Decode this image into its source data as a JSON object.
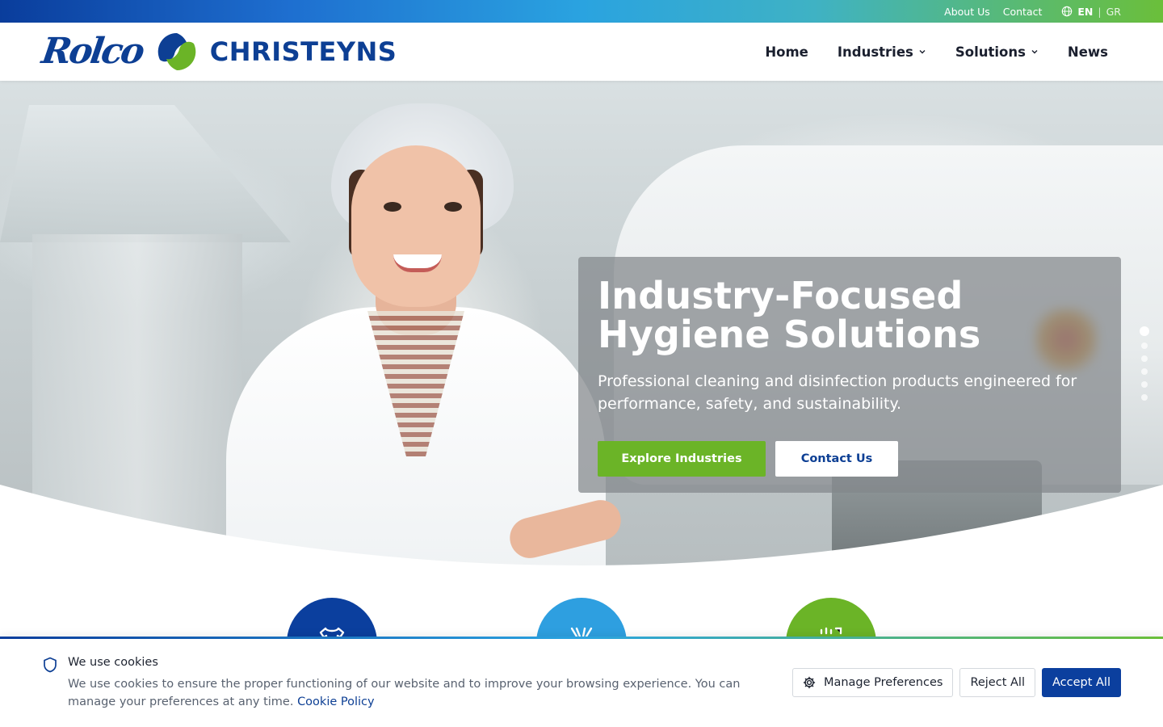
{
  "topbar": {
    "links": [
      "About Us",
      "Contact"
    ],
    "language": {
      "active": "EN",
      "separator": "|",
      "inactive": "GR"
    }
  },
  "header": {
    "logo_rolco": "Rolco",
    "logo_christeyns": "CHRISTEYNS",
    "nav": [
      {
        "label": "Home",
        "has_dropdown": false
      },
      {
        "label": "Industries",
        "has_dropdown": true
      },
      {
        "label": "Solutions",
        "has_dropdown": true
      },
      {
        "label": "News",
        "has_dropdown": false
      }
    ]
  },
  "hero": {
    "title_line1": "Industry-Focused",
    "title_line2": "Hygiene Solutions",
    "subtitle": "Professional cleaning and disinfection products engineered for performance, safety, and sustainability.",
    "primary_button": "Explore Industries",
    "secondary_button": "Contact Us",
    "slides_total": 6,
    "active_slide": 1
  },
  "industry_icons": [
    {
      "icon": "shirt-icon",
      "color": "#0b3f9e"
    },
    {
      "icon": "hands-icon",
      "color": "#2e9fe0"
    },
    {
      "icon": "factory-icon",
      "color": "#6bb427"
    }
  ],
  "cookie_banner": {
    "title": "We use cookies",
    "text": "We use cookies to ensure the proper functioning of our website and to improve your browsing experience. You can manage your preferences at any time.",
    "policy_link": "Cookie Policy",
    "buttons": {
      "manage": "Manage Preferences",
      "reject": "Reject All",
      "accept": "Accept All"
    }
  },
  "colors": {
    "brand_blue": "#0d3f94",
    "brand_green": "#6bb427",
    "brand_light_blue": "#2e9fe0"
  }
}
